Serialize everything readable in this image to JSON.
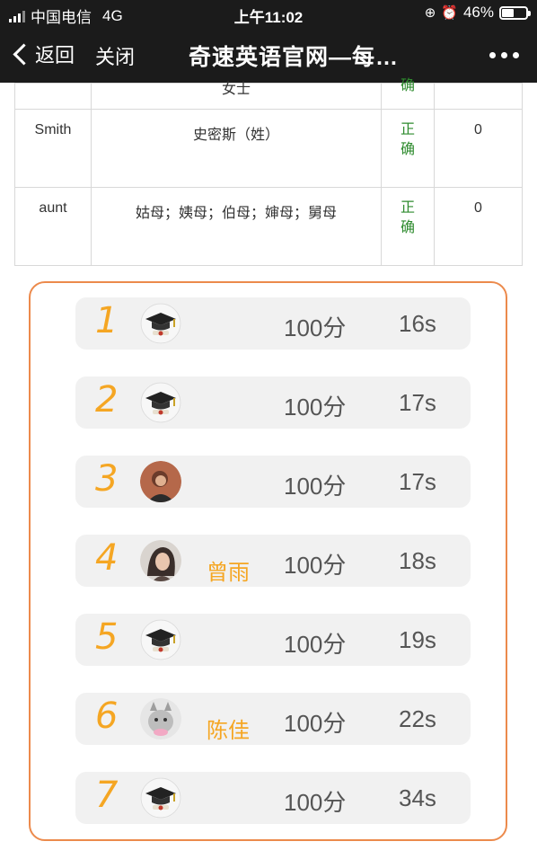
{
  "status_bar": {
    "carrier": "中国电信",
    "network": "4G",
    "time": "上午11:02",
    "battery": "46%",
    "battery_level": 0.46
  },
  "nav": {
    "back_label": "返回",
    "close_label": "关闭",
    "title": "奇速英语官网—每…"
  },
  "table": {
    "cut_row": {
      "meaning": "女士",
      "result": "确"
    },
    "rows": [
      {
        "word": "Smith",
        "meaning": "史密斯（姓）",
        "result_line1": "正",
        "result_line2": "确",
        "count": "0"
      },
      {
        "word": "aunt",
        "meaning": "姑母；姨母；伯母；婶母；舅母",
        "result_line1": "正",
        "result_line2": "确",
        "count": "0"
      }
    ]
  },
  "ranking": [
    {
      "rank": "1",
      "avatar": "graduation-cap-avatar",
      "name": "",
      "score": "100分",
      "time": "16s"
    },
    {
      "rank": "2",
      "avatar": "graduation-cap-avatar",
      "name": "",
      "score": "100分",
      "time": "17s"
    },
    {
      "rank": "3",
      "avatar": "photo-avatar",
      "name": "",
      "score": "100分",
      "time": "17s"
    },
    {
      "rank": "4",
      "avatar": "photo-avatar",
      "name": "曾雨",
      "score": "100分",
      "time": "18s"
    },
    {
      "rank": "5",
      "avatar": "graduation-cap-avatar",
      "name": "",
      "score": "100分",
      "time": "19s"
    },
    {
      "rank": "6",
      "avatar": "photo-avatar",
      "name": "陈佳",
      "score": "100分",
      "time": "22s"
    },
    {
      "rank": "7",
      "avatar": "graduation-cap-avatar",
      "name": "",
      "score": "100分",
      "time": "34s"
    }
  ],
  "colors": {
    "accent_orange": "#f5a623",
    "panel_border": "#ec8a4c",
    "correct_green": "#2e8b2e",
    "bar_dark": "#1b1b1b"
  }
}
